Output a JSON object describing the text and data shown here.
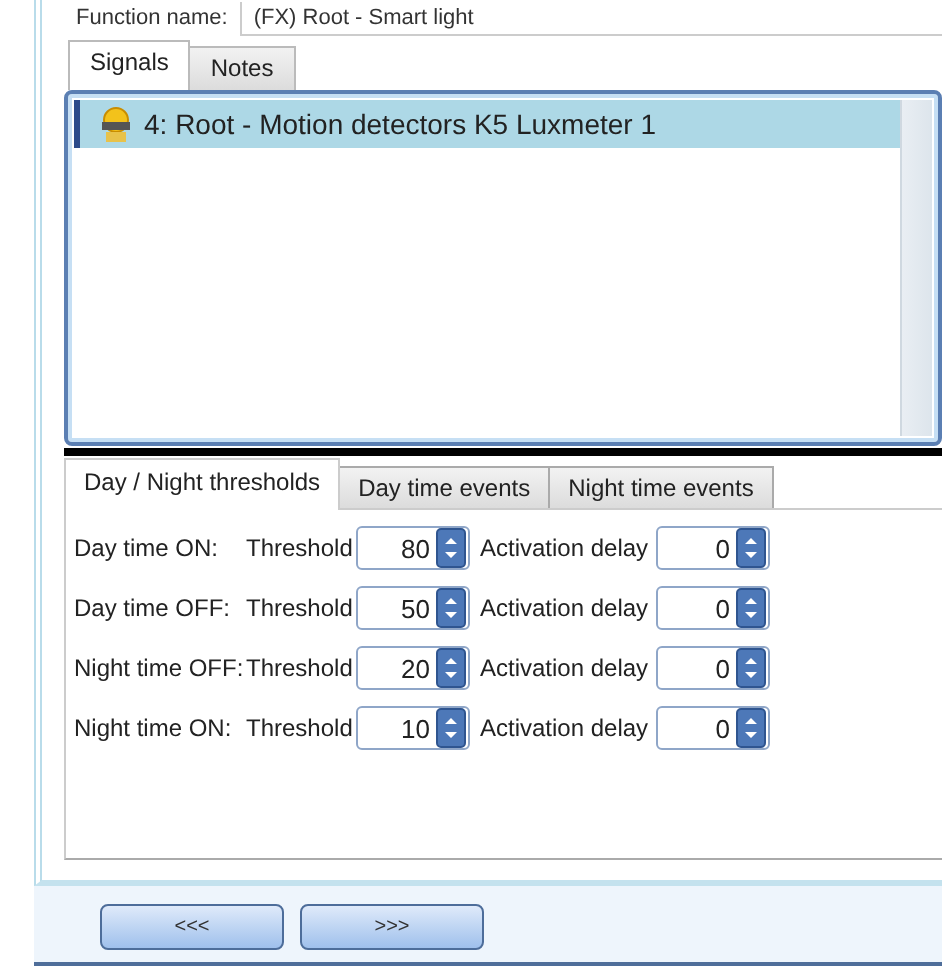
{
  "function_name": {
    "label": "Function name:",
    "value": "(FX) Root - Smart light"
  },
  "tabs": [
    {
      "label": "Signals",
      "selected": true
    },
    {
      "label": "Notes",
      "selected": false
    }
  ],
  "signals": [
    {
      "label": "4: Root - Motion detectors K5 Luxmeter 1",
      "selected": true
    }
  ],
  "threshold_tabs": [
    {
      "label": "Day / Night thresholds",
      "selected": true
    },
    {
      "label": "Day time events",
      "selected": false
    },
    {
      "label": "Night time events",
      "selected": false
    }
  ],
  "rows": [
    {
      "label": "Day time ON:",
      "threshold_label": "Threshold",
      "threshold": "80",
      "delay_label": "Activation delay",
      "delay": "0"
    },
    {
      "label": "Day time OFF:",
      "threshold_label": "Threshold",
      "threshold": "50",
      "delay_label": "Activation delay",
      "delay": "0"
    },
    {
      "label": "Night time OFF:",
      "threshold_label": "Threshold",
      "threshold": "20",
      "delay_label": "Activation delay",
      "delay": "0"
    },
    {
      "label": "Night time ON:",
      "threshold_label": "Threshold",
      "threshold": "10",
      "delay_label": "Activation delay",
      "delay": "0"
    }
  ],
  "buttons": [
    "<<<",
    ">>>"
  ]
}
